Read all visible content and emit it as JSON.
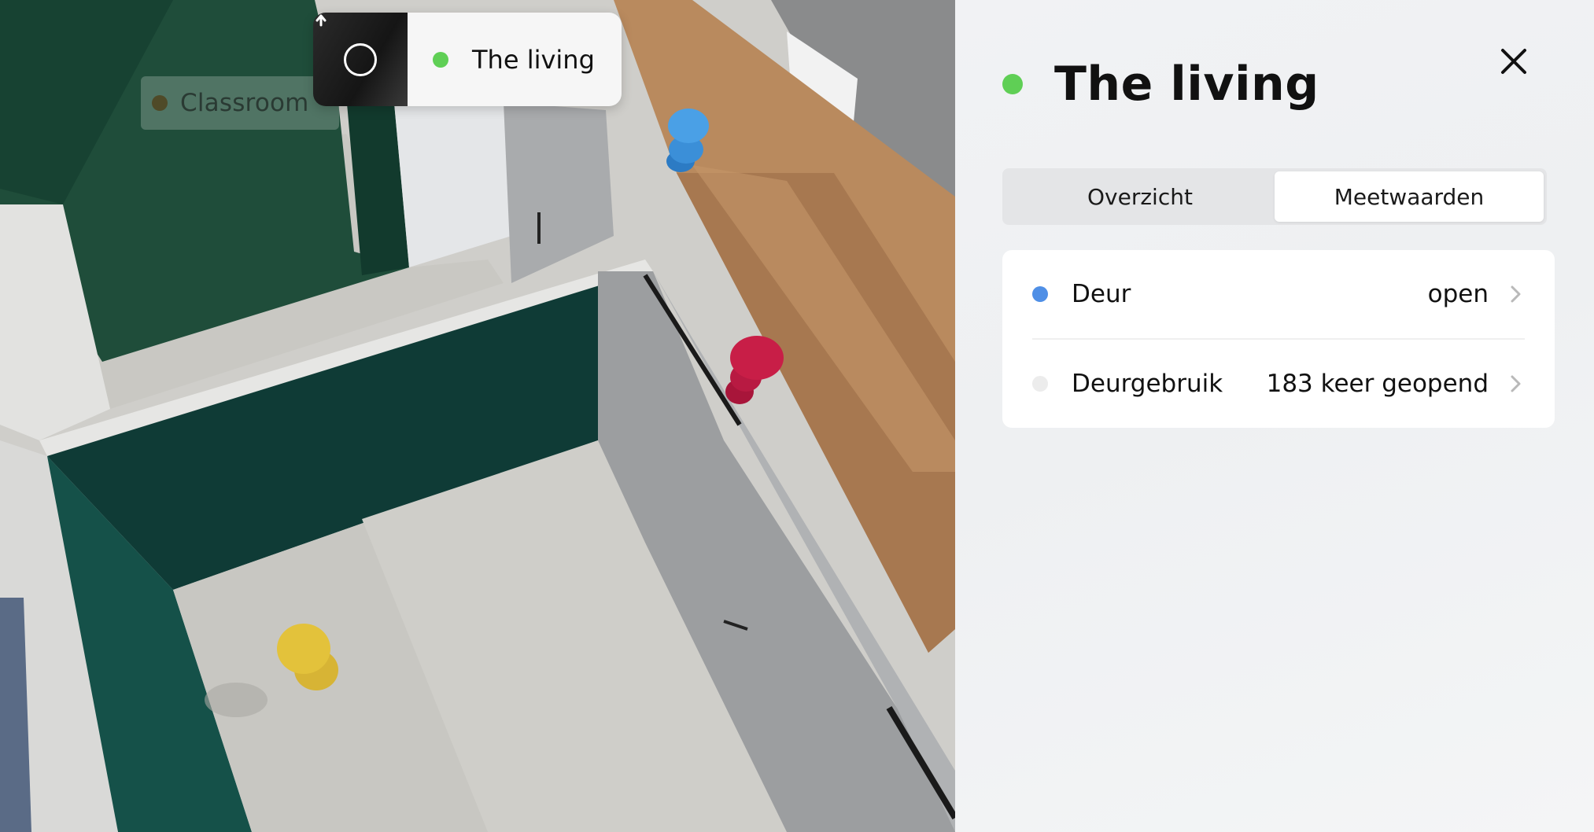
{
  "scene": {
    "room_chip": {
      "label": "Classroom",
      "dot_color": "#4f4a28"
    },
    "breadcrumb": {
      "up_icon": "arrow-up-circle-icon",
      "current_label": "The living",
      "current_dot_color": "#5fcf55"
    },
    "sensors": [
      {
        "name": "blue-sensor-marker",
        "color": "#3b8fd8"
      },
      {
        "name": "red-sensor-marker",
        "color": "#c81e47"
      },
      {
        "name": "yellow-sensor-marker",
        "color": "#e3c23b"
      }
    ]
  },
  "panel": {
    "title": "The living",
    "status_color": "#5fcf55",
    "close_icon": "close-icon",
    "tabs": [
      {
        "label": "Overzicht",
        "active": false
      },
      {
        "label": "Meetwaarden",
        "active": true
      }
    ],
    "measurements": [
      {
        "name": "Deur",
        "value": "open",
        "dot_color": "#4f8fe6"
      },
      {
        "name": "Deurgebruik",
        "value": "183 keer geopend",
        "dot_color": "#ececec"
      }
    ]
  }
}
